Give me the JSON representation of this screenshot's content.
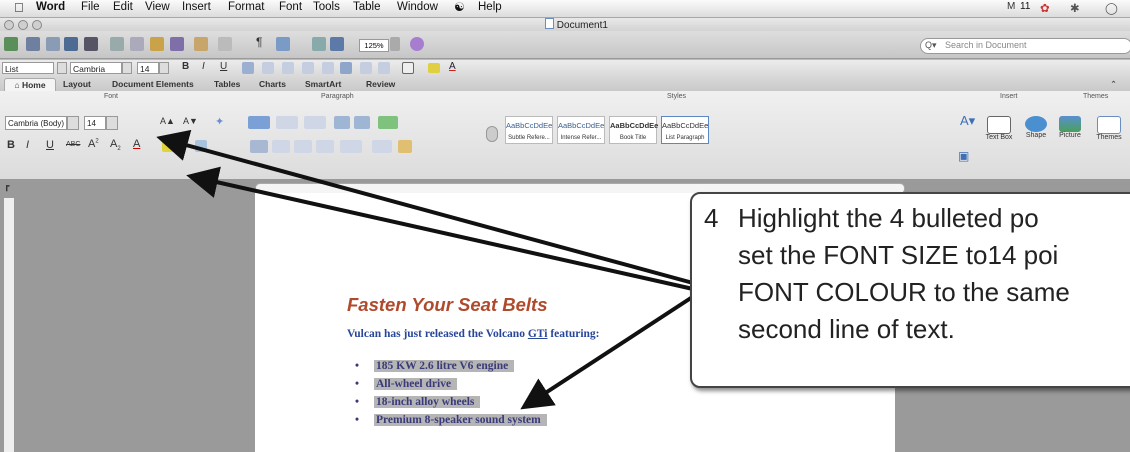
{
  "menubar": {
    "app": "Word",
    "items": [
      "File",
      "Edit",
      "View",
      "Insert",
      "Format",
      "Font",
      "Tools",
      "Table",
      "Window",
      "Help"
    ],
    "clock": "11"
  },
  "window": {
    "title": "Document1"
  },
  "toolbar": {
    "zoom": "125%",
    "search_placeholder": "Search in Document"
  },
  "formatbar": {
    "style": "List Paragraph",
    "font": "Cambria (Bo...",
    "size": "14"
  },
  "ribbon": {
    "tabs": [
      "Home",
      "Layout",
      "Document Elements",
      "Tables",
      "Charts",
      "SmartArt",
      "Review"
    ],
    "groups": {
      "font": "Font",
      "paragraph": "Paragraph",
      "styles": "Styles",
      "insert": "Insert",
      "themes": "Themes"
    },
    "font_name": "Cambria (Body)",
    "font_size": "14",
    "styles": [
      {
        "preview": "AaBbCcDdEe",
        "label": "Subtle Refere..."
      },
      {
        "preview": "AaBbCcDdEe",
        "label": "Intense Refer..."
      },
      {
        "preview": "AaBbCcDdEe",
        "label": "Book Title"
      },
      {
        "preview": "AaBbCcDdEe",
        "label": "List Paragraph"
      }
    ],
    "insert_buttons": [
      "Text Box",
      "Shape",
      "Picture"
    ],
    "themes_button": "Themes"
  },
  "document": {
    "heading": "Fasten Your Seat Belts",
    "subheading_start": "Vulcan has just released the Volcano ",
    "subheading_link": "GTi",
    "subheading_end": " featuring:",
    "bullets": [
      "185 KW 2.6 litre V6 engine",
      "All-wheel drive",
      "18-inch alloy wheels",
      "Premium 8-speaker sound system"
    ]
  },
  "callout": {
    "number": "4",
    "lines": [
      "Highlight the 4 bulleted po",
      "set the FONT SIZE to14 poi",
      "FONT COLOUR to the same",
      "second line of text."
    ]
  },
  "colors": {
    "heading": "#b04a2c",
    "subheading": "#28469a",
    "highlight": "#b5b5b5"
  }
}
